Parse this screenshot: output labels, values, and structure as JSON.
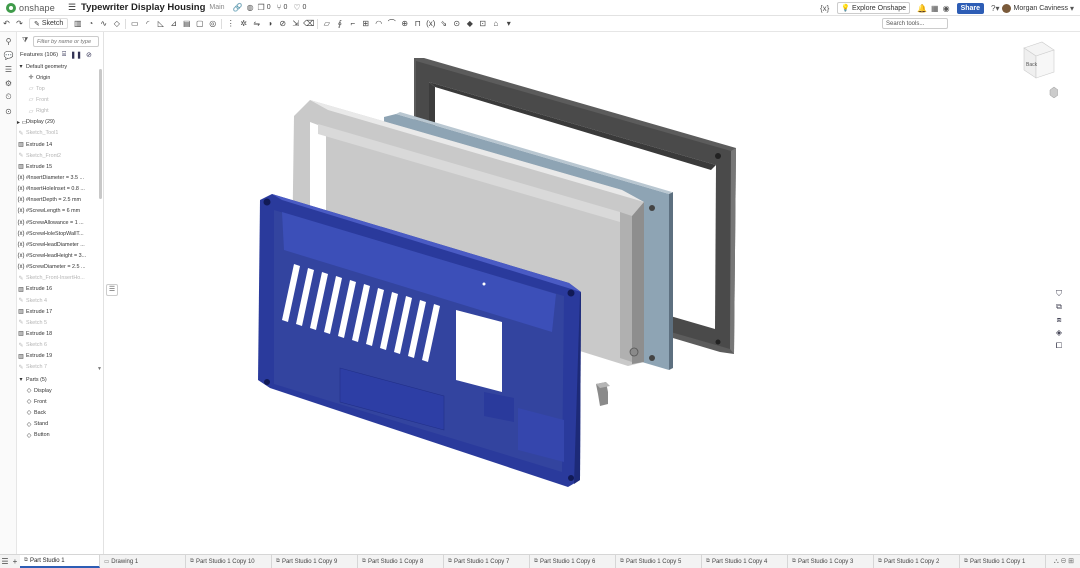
{
  "app": {
    "logo_text": "onshape",
    "document_title": "Typewriter Display Housing",
    "workspace": "Main",
    "counts": {
      "versions": "0",
      "branches": "0",
      "likes": "0"
    },
    "variable_icon": "{x}",
    "explore": "Explore Onshape",
    "share": "Share",
    "user": "Morgan Caviness"
  },
  "toolbar": {
    "sketch_label": "Sketch",
    "search_placeholder": "Search tools..."
  },
  "features": {
    "filter_placeholder": "Filter by name or type",
    "header": "Features (106)",
    "items": [
      {
        "label": "Default geometry",
        "icon": "chevron-down-icon",
        "muted": false
      },
      {
        "label": "Origin",
        "icon": "origin-icon",
        "muted": false
      },
      {
        "label": "Top",
        "icon": "plane-icon",
        "muted": true
      },
      {
        "label": "Front",
        "icon": "plane-icon",
        "muted": true
      },
      {
        "label": "Right",
        "icon": "plane-icon",
        "muted": true
      },
      {
        "label": "Display (29)",
        "icon": "folder-icon",
        "muted": false
      },
      {
        "label": "Sketch_Tool1",
        "icon": "sketch-icon",
        "muted": true
      },
      {
        "label": "Extrude 14",
        "icon": "extrude-icon",
        "muted": false
      },
      {
        "label": "Sketch_Front2",
        "icon": "sketch-icon",
        "muted": true
      },
      {
        "label": "Extrude 15",
        "icon": "extrude-icon",
        "muted": false
      },
      {
        "label": "#InsertDiameter = 3.5 ...",
        "icon": "variable-icon",
        "muted": false
      },
      {
        "label": "#InsertHoleInset = 0.8 ...",
        "icon": "variable-icon",
        "muted": false
      },
      {
        "label": "#InsertDepth = 2.5 mm",
        "icon": "variable-icon",
        "muted": false
      },
      {
        "label": "#ScrewLength = 6 mm",
        "icon": "variable-icon",
        "muted": false
      },
      {
        "label": "#ScrewAllowance = 1 ...",
        "icon": "variable-icon",
        "muted": false
      },
      {
        "label": "#ScrewHoleStopWallT...",
        "icon": "variable-icon",
        "muted": false
      },
      {
        "label": "#ScrewHeadDiameter ...",
        "icon": "variable-icon",
        "muted": false
      },
      {
        "label": "#ScrewHeadHeight = 3...",
        "icon": "variable-icon",
        "muted": false
      },
      {
        "label": "#ScrewDiameter = 2.5 ...",
        "icon": "variable-icon",
        "muted": false
      },
      {
        "label": "Sketch_Front-InsertHo...",
        "icon": "sketch-icon",
        "muted": true
      },
      {
        "label": "Extrude 16",
        "icon": "extrude-icon",
        "muted": false
      },
      {
        "label": "Sketch 4",
        "icon": "sketch-icon",
        "muted": true
      },
      {
        "label": "Extrude 17",
        "icon": "extrude-icon",
        "muted": false
      },
      {
        "label": "Sketch 5",
        "icon": "sketch-icon",
        "muted": true
      },
      {
        "label": "Extrude 18",
        "icon": "extrude-icon",
        "muted": false
      },
      {
        "label": "Sketch 6",
        "icon": "sketch-icon",
        "muted": true
      },
      {
        "label": "Extrude 19",
        "icon": "extrude-icon",
        "muted": false
      },
      {
        "label": "Sketch 7",
        "icon": "sketch-icon",
        "muted": true
      }
    ]
  },
  "parts": {
    "header": "Parts (5)",
    "items": [
      "Display",
      "Front",
      "Back",
      "Stand",
      "Button"
    ]
  },
  "tabs": [
    {
      "label": "Part Studio 1",
      "active": true
    },
    {
      "label": "Drawing 1",
      "active": false
    },
    {
      "label": "Part Studio 1 Copy 10",
      "active": false
    },
    {
      "label": "Part Studio 1 Copy 9",
      "active": false
    },
    {
      "label": "Part Studio 1 Copy 8",
      "active": false
    },
    {
      "label": "Part Studio 1 Copy 7",
      "active": false
    },
    {
      "label": "Part Studio 1 Copy 6",
      "active": false
    },
    {
      "label": "Part Studio 1 Copy 5",
      "active": false
    },
    {
      "label": "Part Studio 1 Copy 4",
      "active": false
    },
    {
      "label": "Part Studio 1 Copy 3",
      "active": false
    },
    {
      "label": "Part Studio 1 Copy 2",
      "active": false
    },
    {
      "label": "Part Studio 1 Copy 1",
      "active": false
    }
  ],
  "viewcube": {
    "face_label": "Back"
  },
  "colors": {
    "accent": "#2d5db5",
    "front_part": "#2a3a9c",
    "back_frame": "#4a4a4a",
    "display_board": "#8ea4b4"
  }
}
